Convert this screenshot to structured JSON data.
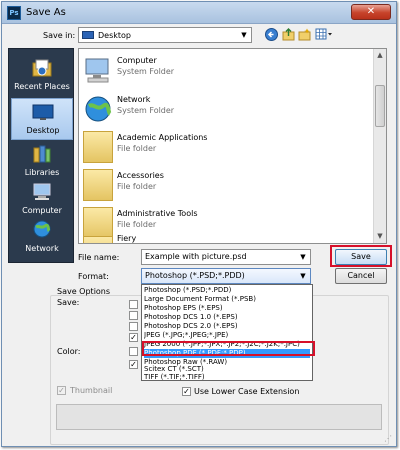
{
  "window": {
    "title": "Save As",
    "app_icon": "Ps",
    "close_glyph": "✕"
  },
  "toolbar": {
    "save_in_label": "Save in:",
    "save_in_value": "Desktop",
    "icons": [
      "back-arrow-icon",
      "up-folder-icon",
      "new-folder-icon",
      "view-menu-icon"
    ]
  },
  "places": [
    {
      "label": "Recent Places",
      "icon": "recent-places-icon"
    },
    {
      "label": "Desktop",
      "icon": "desktop-icon",
      "active": true
    },
    {
      "label": "Libraries",
      "icon": "libraries-icon"
    },
    {
      "label": "Computer",
      "icon": "computer-icon"
    },
    {
      "label": "Network",
      "icon": "network-icon"
    }
  ],
  "files": [
    {
      "name": "Computer",
      "type": "System Folder",
      "icon": "computer-icon"
    },
    {
      "name": "Network",
      "type": "System Folder",
      "icon": "network-globe-icon"
    },
    {
      "name": "Academic Applications",
      "type": "File folder",
      "icon": "folder-icon"
    },
    {
      "name": "Accessories",
      "type": "File folder",
      "icon": "folder-icon"
    },
    {
      "name": "Administrative Tools",
      "type": "File folder",
      "icon": "folder-icon"
    },
    {
      "name": "Fiery",
      "type": "",
      "icon": "folder-icon"
    }
  ],
  "form": {
    "filename_label": "File name:",
    "filename_value": "Example with picture.psd",
    "format_label": "Format:",
    "format_value": "Photoshop (*.PSD;*.PDD)",
    "save_button": "Save",
    "cancel_button": "Cancel"
  },
  "format_options": [
    "Photoshop (*.PSD;*.PDD)",
    "Large Document Format (*.PSB)",
    "Photoshop EPS (*.EPS)",
    "Photoshop DCS 1.0 (*.EPS)",
    "Photoshop DCS 2.0 (*.EPS)",
    "JPEG (*.JPG;*.JPEG;*.JPE)",
    "JPEG 2000 (*.JPF;*.JPX;*.JP2;*.J2C;*.J2K;*.JPC)",
    "Photoshop PDF (*.PDF;*.PDP)",
    "Photoshop Raw (*.RAW)",
    "Scitex CT (*.SCT)",
    "TIFF (*.TIF;*.TIFF)"
  ],
  "format_selected": "Photoshop PDF (*.PDF;*.PDP)",
  "options": {
    "title": "Save Options",
    "save_label": "Save:",
    "color_label": "Color:",
    "thumbnail_label": "Thumbnail",
    "thumbnail_checked": true,
    "thumbnail_disabled": true,
    "lowercase_label": "Use Lower Case Extension",
    "lowercase_checked": true
  },
  "colors": {
    "highlight": "#d6102a",
    "selection": "#3399ff",
    "places_bg": "#2b3a4d"
  }
}
